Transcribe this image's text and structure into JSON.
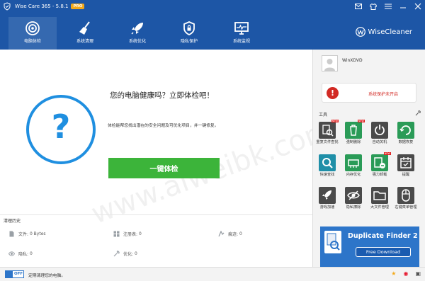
{
  "titlebar": {
    "title": "Wise Care 365 - 5.8.1",
    "badge": "PRO",
    "controls": [
      "mail-icon",
      "shirt-icon",
      "menu-icon",
      "minimize-icon",
      "close-icon"
    ]
  },
  "tabs": [
    {
      "label": "电脑体检",
      "icon": "target-icon",
      "active": true
    },
    {
      "label": "系统清理",
      "icon": "broom-icon",
      "active": false
    },
    {
      "label": "系统优化",
      "icon": "rocket-icon",
      "active": false
    },
    {
      "label": "隐私保护",
      "icon": "shield-icon",
      "active": false
    },
    {
      "label": "系统监视",
      "icon": "monitor-icon",
      "active": false
    }
  ],
  "brand": {
    "name": "WiseCleaner"
  },
  "main": {
    "headline": "您的电脑健康吗？立即体检吧！",
    "description": "体检能帮您找出潜在的安全问题及可优化项目，并一键修复。",
    "check_button": "一键体检"
  },
  "history": {
    "title": "清理历史",
    "items": [
      {
        "label": "文件:",
        "value": "0 Bytes",
        "icon": "file-icon"
      },
      {
        "label": "注册表:",
        "value": "0",
        "icon": "registry-icon"
      },
      {
        "label": "痕迹:",
        "value": "0",
        "icon": "trace-icon"
      },
      {
        "label": "隐私:",
        "value": "0",
        "icon": "eye-icon"
      },
      {
        "label": "优化:",
        "value": "0",
        "icon": "wrench-icon"
      }
    ]
  },
  "user": {
    "name": "WinXDVD"
  },
  "status": {
    "text": "系统保护未开启"
  },
  "tools": {
    "title": "工具",
    "items": [
      {
        "label": "重复文件查找",
        "icon": "duplicate-search-icon",
        "color": "#4a4a4a",
        "new": true
      },
      {
        "label": "强制删除",
        "icon": "trash-icon",
        "color": "#2a9b57",
        "new": true
      },
      {
        "label": "自动关机",
        "icon": "power-icon",
        "color": "#4a4a4a",
        "new": false
      },
      {
        "label": "数据恢复",
        "icon": "recover-icon",
        "color": "#2a9b57",
        "new": false
      },
      {
        "label": "快速查找",
        "icon": "magnifier-icon",
        "color": "#1f8fa8",
        "new": false
      },
      {
        "label": "内存优化",
        "icon": "memory-icon",
        "color": "#2a9b57",
        "new": false
      },
      {
        "label": "强力卸载",
        "icon": "uninstall-icon",
        "color": "#2a9b57",
        "new": true
      },
      {
        "label": "提醒",
        "icon": "calendar-icon",
        "color": "#4a4a4a",
        "new": false
      },
      {
        "label": "游戏加速",
        "icon": "game-rocket-icon",
        "color": "#4a4a4a",
        "new": false
      },
      {
        "label": "隐私擦除",
        "icon": "eye-off-icon",
        "color": "#4a4a4a",
        "new": false
      },
      {
        "label": "大文件管理",
        "icon": "folder-icon",
        "color": "#4a4a4a",
        "new": false
      },
      {
        "label": "右键菜单管理",
        "icon": "mouse-icon",
        "color": "#4a4a4a",
        "new": false
      }
    ]
  },
  "ad": {
    "title": "Duplicate Finder 2",
    "button": "Free Download"
  },
  "bottom": {
    "toggle": "OFF",
    "text": "定期清理您的电脑。",
    "icons": [
      "star-icon",
      "weibo-icon",
      "ticket-icon"
    ]
  },
  "colors": {
    "titlebar": "#1d56a6",
    "accent": "#1f8fe0",
    "check_button": "#3cb43a",
    "status_red": "#d22a24"
  }
}
